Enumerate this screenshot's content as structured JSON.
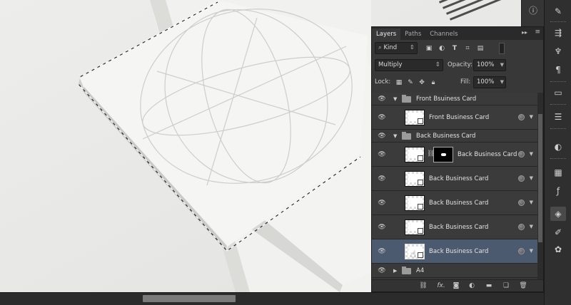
{
  "panel": {
    "tabs": [
      {
        "label": "Layers",
        "active": true
      },
      {
        "label": "Paths",
        "active": false
      },
      {
        "label": "Channels",
        "active": false
      }
    ],
    "collapse_glyph": "▸▸",
    "menu_glyph": "≡",
    "filter": {
      "label": "Kind",
      "icons": [
        "image-filter-icon",
        "adjustment-filter-icon",
        "type-filter-icon",
        "shape-filter-icon",
        "smart-object-filter-icon"
      ]
    },
    "blend_mode": "Multiply",
    "opacity": {
      "label": "Opacity:",
      "value": "100%"
    },
    "lock": {
      "label": "Lock:"
    },
    "fill": {
      "label": "Fill:",
      "value": "100%"
    }
  },
  "layers": [
    {
      "type": "group",
      "name": "Front Bsuiness Card",
      "expanded": true
    },
    {
      "type": "layer",
      "name": "Front Business Card",
      "smart_object": true,
      "selected": false
    },
    {
      "type": "group",
      "name": "Back Business Card",
      "expanded": true
    },
    {
      "type": "layer",
      "name": "Back Business Card",
      "smart_object": true,
      "has_mask": true,
      "selected": false
    },
    {
      "type": "layer",
      "name": "Back Business Card",
      "smart_object": true,
      "selected": false
    },
    {
      "type": "layer",
      "name": "Back Business Card",
      "smart_object": true,
      "selected": false
    },
    {
      "type": "layer",
      "name": "Back Business Card",
      "smart_object": true,
      "selected": false
    },
    {
      "type": "layer",
      "name": "Back Business Card",
      "smart_object": true,
      "selected": true
    },
    {
      "type": "group",
      "name": "A4",
      "expanded": false
    }
  ],
  "footer_icons": [
    "link-layers-icon",
    "fx-icon",
    "add-mask-icon",
    "adjustment-layer-icon",
    "new-group-icon",
    "new-layer-icon",
    "delete-layer-icon"
  ],
  "footer_labels": {
    "fx": "fx."
  },
  "right_strip_icons": [
    "info-icon",
    "brush-presets-icon",
    "clone-source-icon",
    "tool-presets-icon",
    "character-icon",
    "properties-icon",
    "adjustments-icon",
    "swatches-icon",
    "styles-icon",
    "layers-icon",
    "paths-icon",
    "channels-icon"
  ],
  "colors": {
    "panel": "#383838",
    "selected": "#4c5a70",
    "canvas": "#e9e9e7"
  }
}
